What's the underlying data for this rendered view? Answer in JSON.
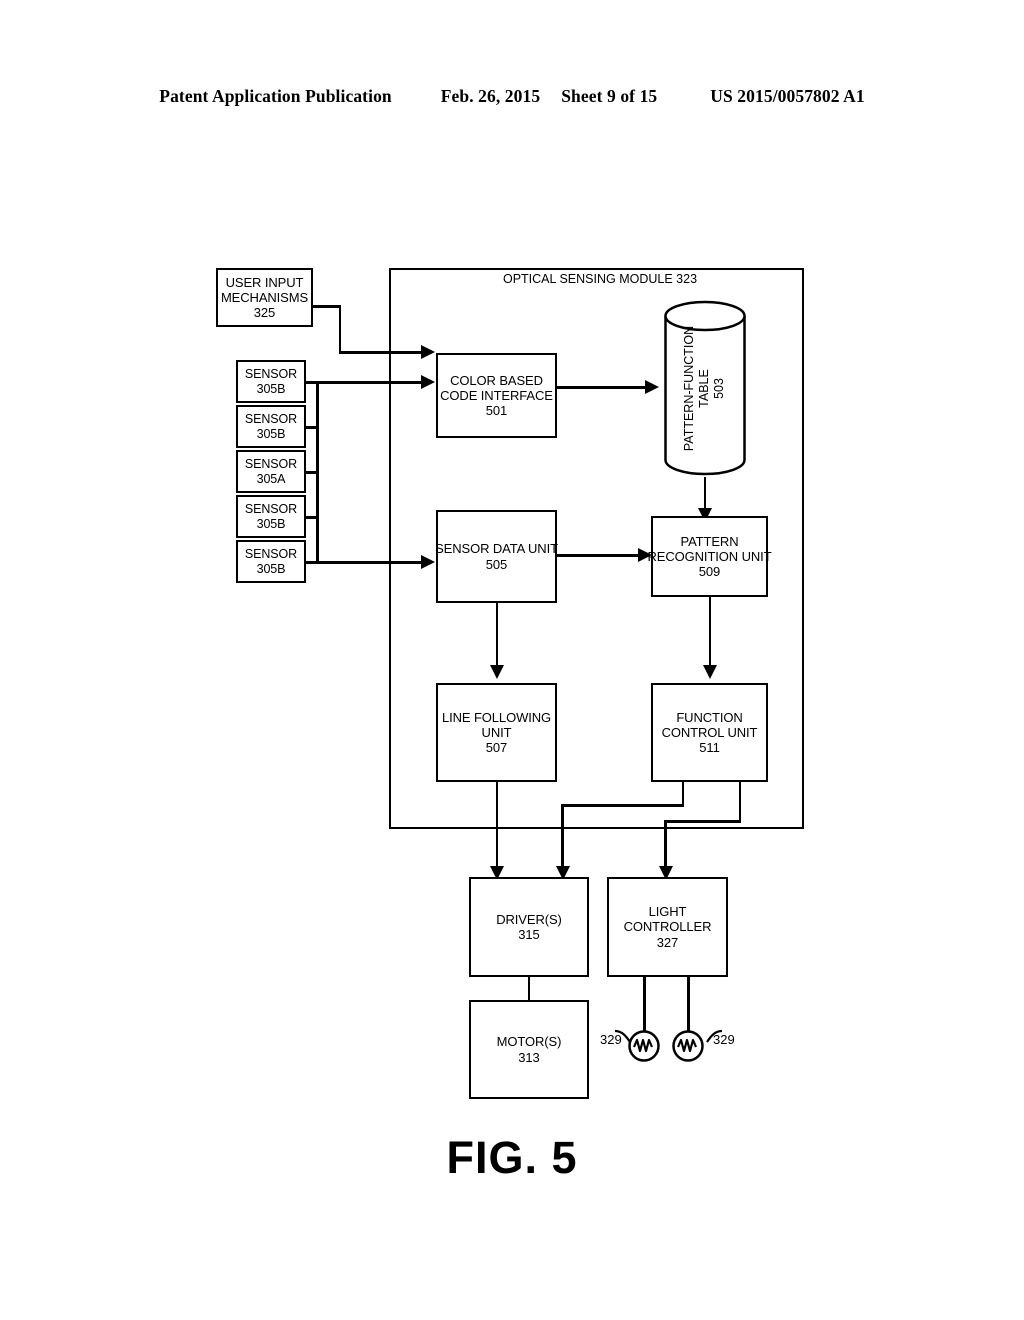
{
  "header": {
    "publication": "Patent Application Publication",
    "date": "Feb. 26, 2015",
    "sheet": "Sheet 9 of 15",
    "docnumber": "US 2015/0057802 A1"
  },
  "figure": {
    "caption": "FIG. 5",
    "module": {
      "title": "OPTICAL SENSING MODULE",
      "ref": "323"
    },
    "nodes": {
      "user_input": {
        "line1": "USER INPUT",
        "line2": "MECHANISMS",
        "ref": "325"
      },
      "color_code_interface": {
        "line1": "COLOR BASED",
        "line2": "CODE INTERFACE",
        "ref": "501"
      },
      "pattern_function_table": {
        "line1": "PATTERN-FUNCTION",
        "line2": "TABLE",
        "ref": "503"
      },
      "sensor_data_unit": {
        "line1": "SENSOR DATA UNIT",
        "ref": "505"
      },
      "pattern_recognition_unit": {
        "line1": "PATTERN",
        "line2": "RECOGNITION UNIT",
        "ref": "509"
      },
      "line_following_unit": {
        "line1": "LINE FOLLOWING",
        "line2": "UNIT",
        "ref": "507"
      },
      "function_control_unit": {
        "line1": "FUNCTION",
        "line2": "CONTROL UNIT",
        "ref": "511"
      },
      "drivers": {
        "line1": "DRIVER(S)",
        "ref": "315"
      },
      "light_controller": {
        "line1": "LIGHT",
        "line2": "CONTROLLER",
        "ref": "327"
      },
      "motors": {
        "line1": "MOTOR(S)",
        "ref": "313"
      }
    },
    "sensors": [
      {
        "label": "SENSOR",
        "ref": "305B"
      },
      {
        "label": "SENSOR",
        "ref": "305B"
      },
      {
        "label": "SENSOR",
        "ref": "305A"
      },
      {
        "label": "SENSOR",
        "ref": "305B"
      },
      {
        "label": "SENSOR",
        "ref": "305B"
      }
    ],
    "lamps": [
      {
        "ref": "329"
      },
      {
        "ref": "329"
      }
    ],
    "colors": {
      "ink": "#000000",
      "paper": "#ffffff"
    }
  }
}
